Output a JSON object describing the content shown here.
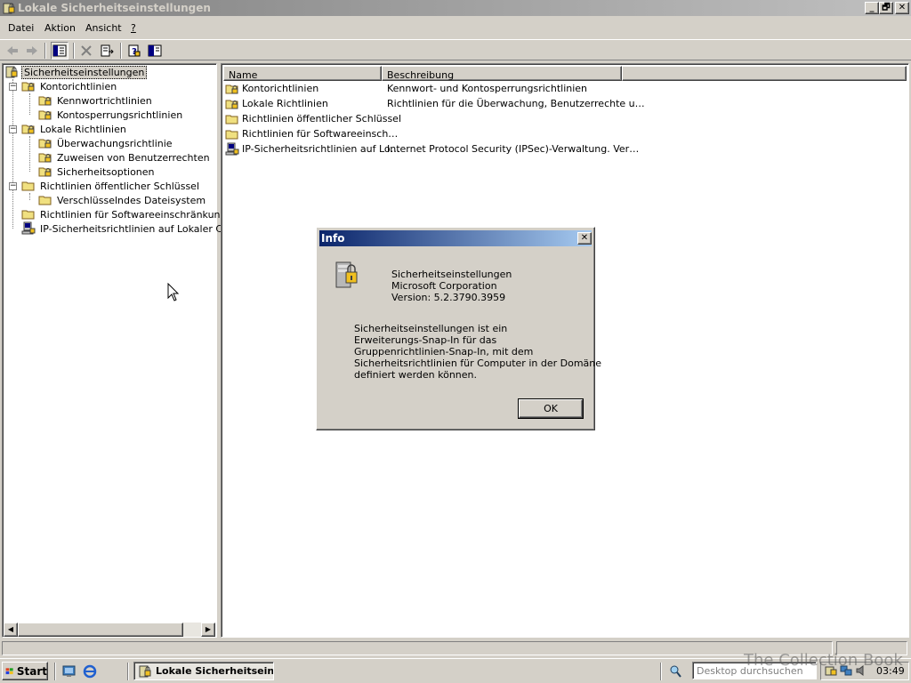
{
  "window": {
    "title": "Lokale Sicherheitseinstellungen",
    "controls": {
      "minimize": "_",
      "maximize": "🗗",
      "close": "✕"
    }
  },
  "menu": [
    {
      "label": "Datei"
    },
    {
      "label": "Aktion"
    },
    {
      "label": "Ansicht"
    },
    {
      "label": "?"
    }
  ],
  "toolbar": {
    "icons": [
      "back-arrow-icon",
      "forward-arrow-icon",
      "show-hide-tree-icon",
      "delete-icon",
      "export-list-icon",
      "help-icon",
      "properties-icon"
    ]
  },
  "tree": {
    "items": [
      {
        "label": "Sicherheitseinstellungen",
        "icon": "security-settings-icon",
        "selected": true
      },
      {
        "label": "Kontorichtlinien",
        "icon": "policy-folder-icon",
        "expander": "−"
      },
      {
        "label": "Kennwortrichtlinien",
        "icon": "policy-folder-icon"
      },
      {
        "label": "Kontosperrungsrichtlinien",
        "icon": "policy-folder-icon"
      },
      {
        "label": "Lokale Richtlinien",
        "icon": "policy-folder-icon",
        "expander": "−"
      },
      {
        "label": "Überwachungsrichtlinie",
        "icon": "policy-folder-icon"
      },
      {
        "label": "Zuweisen von Benutzerrechten",
        "icon": "policy-folder-icon"
      },
      {
        "label": "Sicherheitsoptionen",
        "icon": "policy-folder-icon"
      },
      {
        "label": "Richtlinien öffentlicher Schlüssel",
        "icon": "folder-icon",
        "expander": "−"
      },
      {
        "label": "Verschlüsselndes Dateisystem",
        "icon": "folder-icon"
      },
      {
        "label": "Richtlinien für Softwareeinschränkung",
        "icon": "folder-icon"
      },
      {
        "label": "IP-Sicherheitsrichtlinien auf Lokaler Comp",
        "icon": "ipsec-icon"
      }
    ]
  },
  "list": {
    "columns": [
      "Name",
      "Beschreibung"
    ],
    "rows": [
      {
        "name": "Kontorichtlinien",
        "description": "Kennwort- und Kontosperrungsrichtlinien",
        "icon": "policy-folder-icon"
      },
      {
        "name": "Lokale Richtlinien",
        "description": "Richtlinien für die Überwachung, Benutzerrechte u…",
        "icon": "policy-folder-icon"
      },
      {
        "name": "Richtlinien öffentlicher Schlüssel",
        "description": "",
        "icon": "folder-icon"
      },
      {
        "name": "Richtlinien für Softwareeinsch…",
        "description": "",
        "icon": "folder-icon"
      },
      {
        "name": "IP-Sicherheitsrichtlinien auf Lo…",
        "description": "Internet Protocol Security (IPSec)-Verwaltung. Ver…",
        "icon": "ipsec-icon"
      }
    ]
  },
  "dialog": {
    "title": "Info",
    "product": "Sicherheitseinstellungen",
    "company": "Microsoft Corporation",
    "version": "Version: 5.2.3790.3959",
    "description_lines": [
      "Sicherheitseinstellungen ist ein",
      "Erweiterungs-Snap-In für das",
      "Gruppenrichtlinien-Snap-In, mit dem",
      "Sicherheitsrichtlinien für Computer in der Domäne",
      "definiert werden können."
    ],
    "ok_label": "OK",
    "close_label": "✕"
  },
  "taskbar": {
    "start_label": "Start",
    "app_label": "Lokale Sicherheitsein...",
    "deskbar_placeholder": "Desktop durchsuchen",
    "clock": "03:49"
  },
  "watermark": "The Collection Book",
  "colors": {
    "dialog_title_start": "#0a246a",
    "dialog_title_end": "#a6caf0",
    "window_title_inactive_start": "#808080",
    "window_title_inactive_end": "#c0c0c0",
    "face": "#d4d0c8"
  }
}
